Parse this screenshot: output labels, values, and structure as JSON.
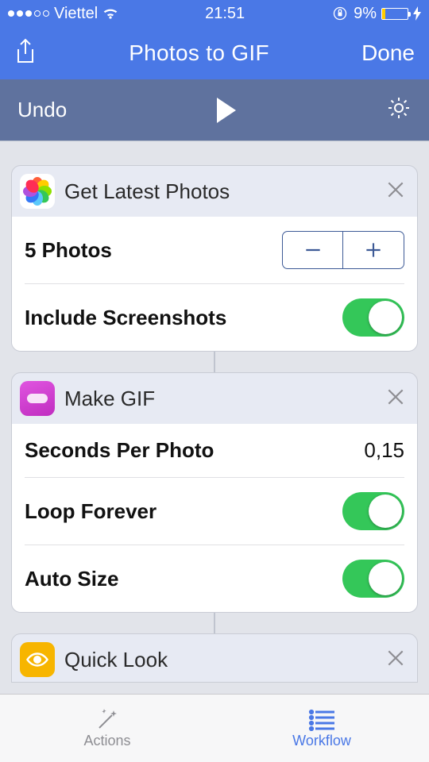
{
  "statusbar": {
    "carrier": "Viettel",
    "time": "21:51",
    "battery_pct": "9%"
  },
  "navbar": {
    "title": "Photos to GIF",
    "done": "Done"
  },
  "toolbar": {
    "undo": "Undo"
  },
  "cards": {
    "get_photos": {
      "title": "Get Latest Photos",
      "count_label": "5 Photos",
      "screenshots_label": "Include Screenshots"
    },
    "make_gif": {
      "title": "Make GIF",
      "seconds_label": "Seconds Per Photo",
      "seconds_value": "0,15",
      "loop_label": "Loop Forever",
      "autosize_label": "Auto Size"
    },
    "quick_look": {
      "title": "Quick Look"
    }
  },
  "tabbar": {
    "actions": "Actions",
    "workflow": "Workflow"
  }
}
